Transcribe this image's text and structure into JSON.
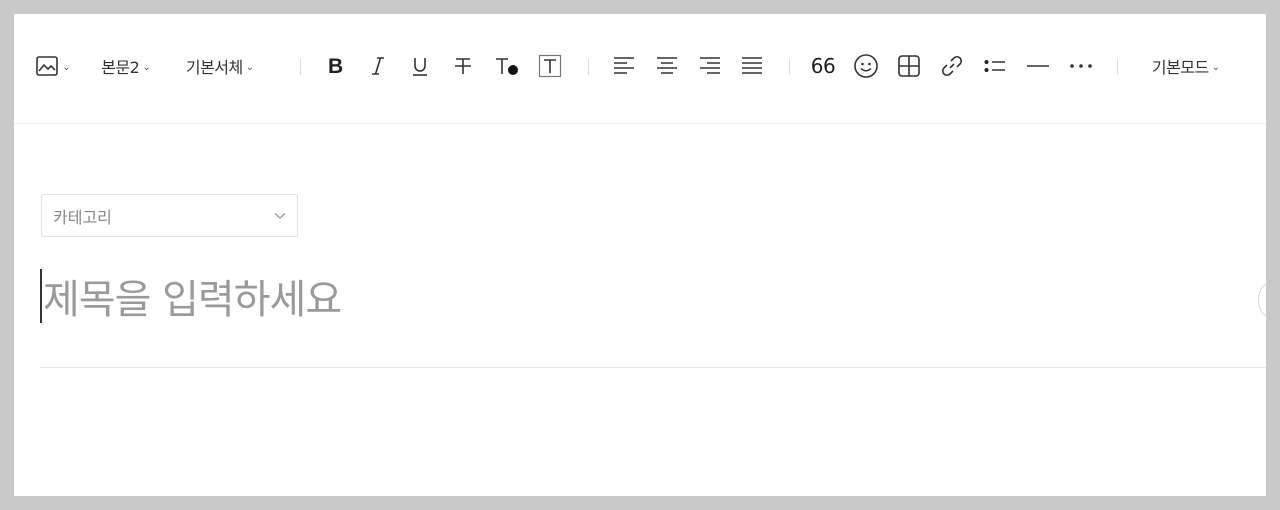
{
  "toolbar": {
    "paragraph_style": "본문2",
    "font_family": "기본서체",
    "quote_label": "66",
    "mode": "기본모드"
  },
  "editor": {
    "category_placeholder": "카테고리",
    "title_placeholder": "제목을 입력하세요"
  },
  "icons": {
    "image": "image-icon",
    "bold": "bold-icon",
    "italic": "italic-icon",
    "underline": "underline-icon",
    "strike": "strikethrough-icon",
    "text_color": "text-color-icon",
    "text_bg": "text-background-icon",
    "align_left": "align-left-icon",
    "align_center": "align-center-icon",
    "align_right": "align-right-icon",
    "align_justify": "align-justify-icon",
    "emoji": "emoji-icon",
    "table": "table-icon",
    "link": "link-icon",
    "list": "bullet-list-icon",
    "hr": "horizontal-rule-icon",
    "more": "more-icon"
  }
}
